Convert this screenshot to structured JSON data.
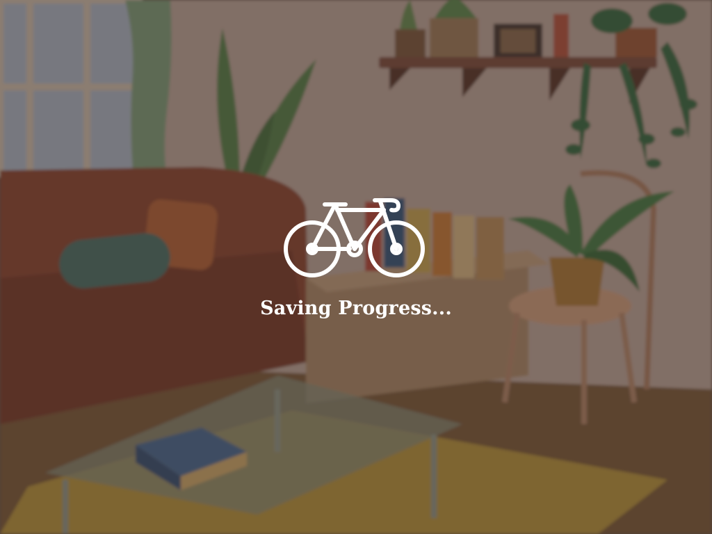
{
  "loading_screen": {
    "status_text": "Saving Progress...",
    "icon": "bicycle-icon"
  },
  "background": {
    "scene": "living-room-illustration",
    "blurred": true
  },
  "colors": {
    "overlay": "#281e19",
    "text": "#ffffff",
    "wall": "#b8a093",
    "sofa": "#8c4b38",
    "floor": "#7a5a3a",
    "rug": "#b08a3a",
    "plant": "#4f7a44"
  }
}
